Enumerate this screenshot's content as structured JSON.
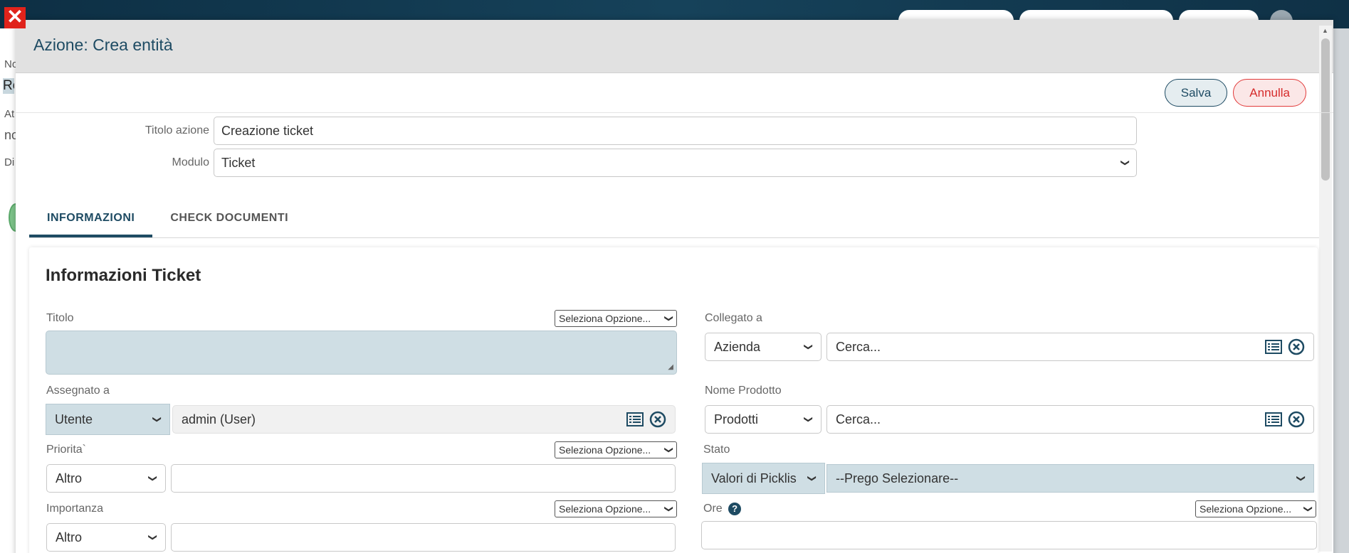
{
  "modal": {
    "title": "Azione: Crea entità",
    "save_label": "Salva",
    "cancel_label": "Annulla"
  },
  "action": {
    "title_label": "Titolo azione",
    "title_value": "Creazione ticket",
    "module_label": "Modulo",
    "module_value": "Ticket"
  },
  "tabs": [
    {
      "label": "INFORMAZIONI",
      "active": true
    },
    {
      "label": "CHECK DOCUMENTI",
      "active": false
    }
  ],
  "section": {
    "title": "Informazioni Ticket",
    "fields": {
      "titolo": {
        "label": "Titolo",
        "option": "Seleziona Opzione..."
      },
      "collegato": {
        "label": "Collegato a",
        "type": "Azienda",
        "placeholder": "Cerca..."
      },
      "assegnato": {
        "label": "Assegnato a",
        "type": "Utente",
        "value": "admin (User)"
      },
      "prodotto": {
        "label": "Nome Prodotto",
        "type": "Prodotti",
        "placeholder": "Cerca..."
      },
      "priorita": {
        "label": "Priorita`",
        "option": "Seleziona Opzione...",
        "type": "Altro"
      },
      "stato": {
        "label": "Stato",
        "type": "Valori di Picklis",
        "value": "--Prego Selezionare--"
      },
      "importanza": {
        "label": "Importanza",
        "option": "Seleziona Opzione...",
        "type": "Altro"
      },
      "ore": {
        "label": "Ore",
        "option": "Seleziona Opzione...",
        "help": "?"
      }
    }
  },
  "background": {
    "frag1": "No",
    "frag2": "Re",
    "frag3": "At",
    "frag4": "no",
    "frag5": "Di"
  }
}
